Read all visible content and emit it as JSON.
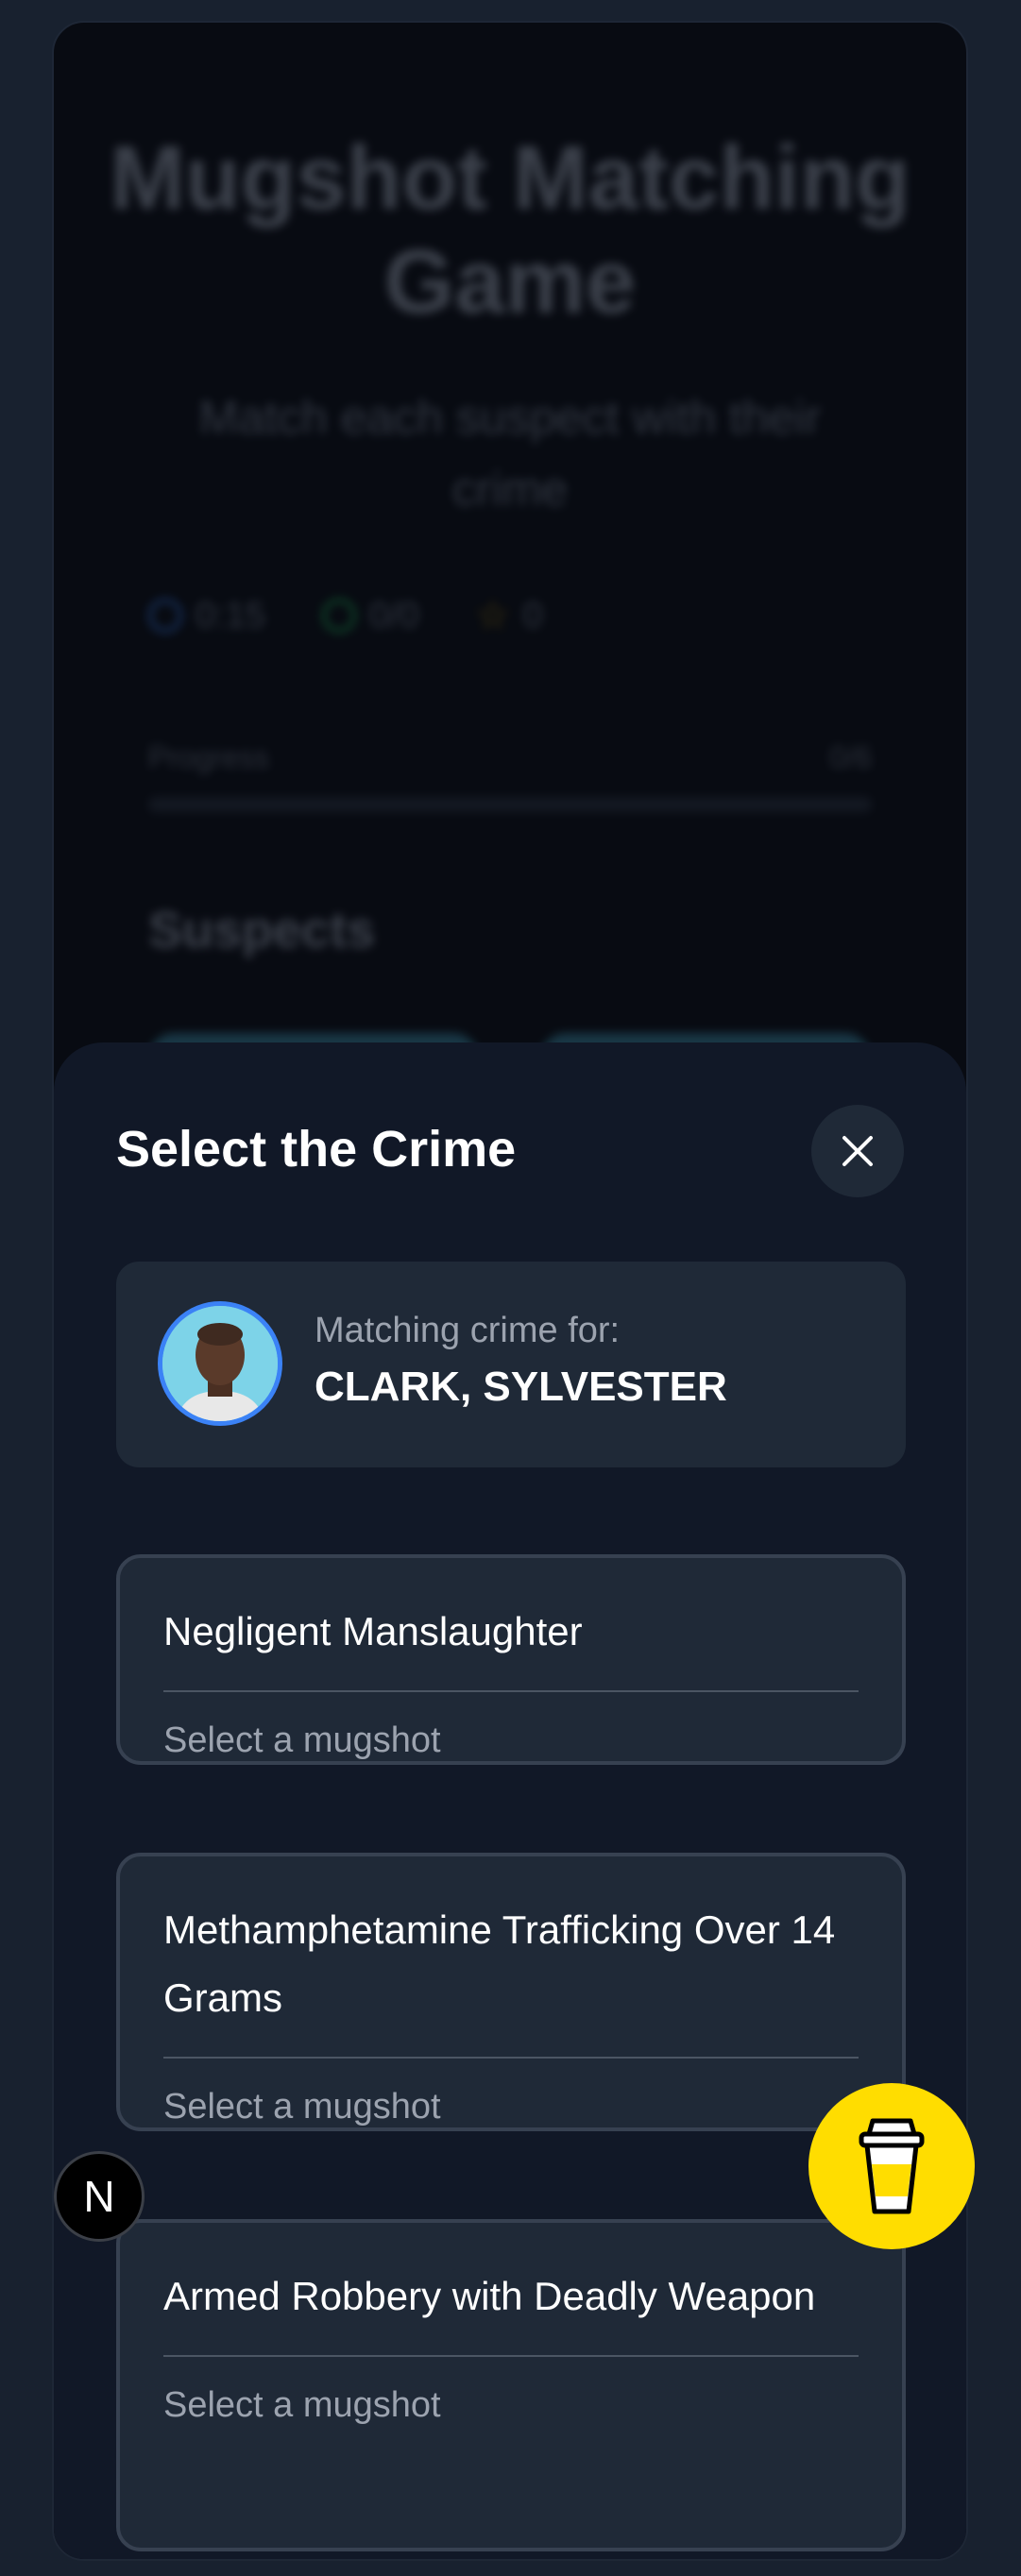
{
  "background": {
    "title": "Mugshot Matching Game",
    "subtitle": "Match each suspect with their crime",
    "stats": [
      {
        "icon": "timer-icon",
        "value": "0:15",
        "color": "#3b82f6"
      },
      {
        "icon": "target-icon",
        "value": "0/0",
        "color": "#22c55e"
      },
      {
        "icon": "star-icon",
        "value": "0",
        "color": "#eab308"
      }
    ],
    "progress": {
      "label": "Progress",
      "value": "0/6"
    },
    "section_heading": "Suspects"
  },
  "sheet": {
    "title": "Select the Crime",
    "matching_label": "Matching crime for:",
    "suspect_name": "CLARK, SYLVESTER",
    "crimes": [
      {
        "title": "Negligent Manslaughter",
        "hint": "Select a mugshot"
      },
      {
        "title": "Methamphetamine Trafficking Over 14 Grams",
        "hint": "Select a mugshot"
      },
      {
        "title": "Armed Robbery with Deadly Weapon",
        "hint": "Select a mugshot"
      }
    ]
  },
  "overlays": {
    "framework_badge": "N"
  },
  "colors": {
    "accent": "#3b82f6",
    "coffee_button": "#ffdd00",
    "sheet_background": "#111827",
    "card_background": "#1f2937"
  }
}
